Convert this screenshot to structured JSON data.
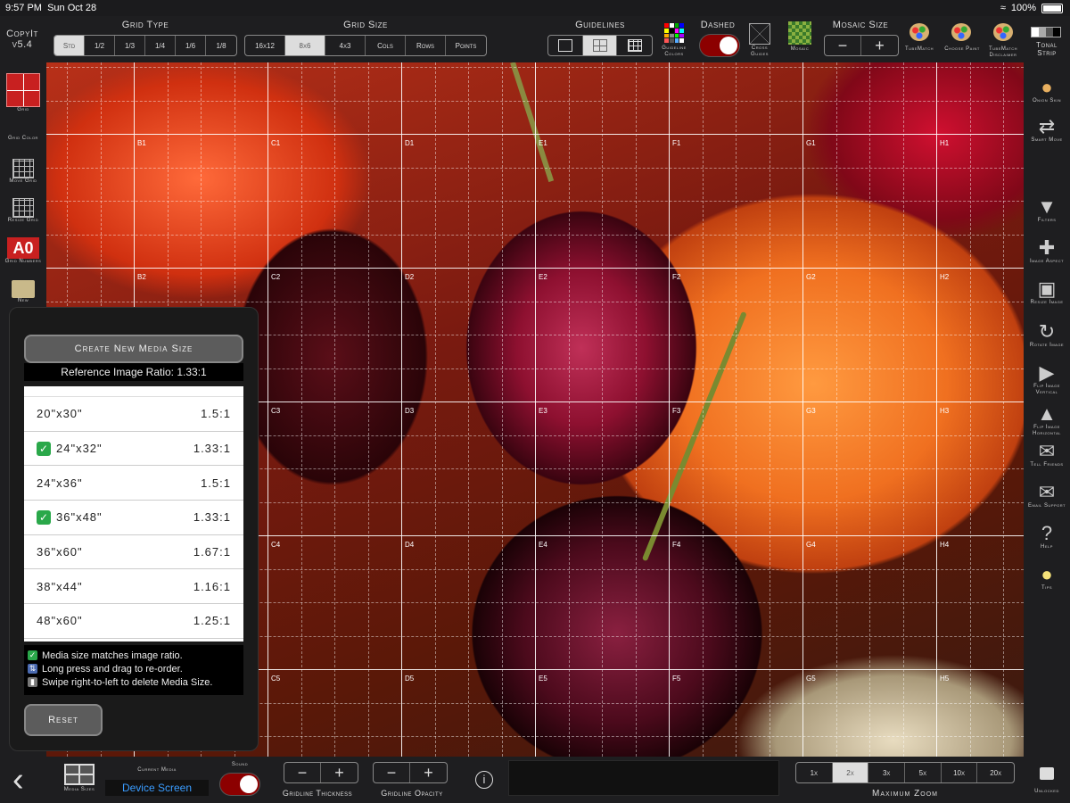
{
  "status": {
    "time": "9:57 PM",
    "date": "Sun Oct 28",
    "battery": "100%"
  },
  "app": {
    "name": "CopyIt",
    "version": "v5.4"
  },
  "toolbar": {
    "grid_type_label": "Grid Type",
    "grid_type_options": [
      "Std",
      "1/2",
      "1/3",
      "1/4",
      "1/6",
      "1/8"
    ],
    "grid_type_selected": "Std",
    "grid_size_label": "Grid Size",
    "grid_size_options": [
      "16x12",
      "8x6",
      "4x3",
      "Cols",
      "Rows",
      "Points"
    ],
    "grid_size_selected": "8x6",
    "guidelines_label": "Guidelines",
    "guideline_colors_label": "Guideline Colors",
    "dashed_label": "Dashed",
    "cross_guides_label": "Cross Guides",
    "mosaic_label": "Mosaic",
    "mosaic_size_label": "Mosaic Size",
    "tubematch_label": "TubeMatch",
    "choose_paint_label": "Choose Paint",
    "tubematch_disclaimer_label": "TubeMatch Disclaimer",
    "tonal_strip_label": "Tonal Strip"
  },
  "left_sidebar": [
    "Grid",
    "Grid Color",
    "Move Grid",
    "Resize Grid",
    "Grid Numbers",
    "New"
  ],
  "grid_numbers_badge": "A0",
  "right_sidebar": [
    "Onion Skin",
    "Smart Move",
    "Filters",
    "Image Aspect",
    "Resize Image",
    "Rotate Image",
    "Flip Image Vertical",
    "Flip Image Horizontal",
    "Tell Friends",
    "Email Support",
    "Help",
    "Tips"
  ],
  "grid_labels": {
    "cols": [
      "B",
      "C",
      "D",
      "E",
      "F",
      "G",
      "H"
    ],
    "rows": [
      "1",
      "2",
      "3",
      "4",
      "5"
    ]
  },
  "panel": {
    "create_button": "Create New Media Size",
    "ratio_text": "Reference Image Ratio: 1.33:1",
    "sizes": [
      {
        "size": "20\"x30\"",
        "ratio": "1.5:1",
        "match": false
      },
      {
        "size": "24\"x32\"",
        "ratio": "1.33:1",
        "match": true
      },
      {
        "size": "24\"x36\"",
        "ratio": "1.5:1",
        "match": false
      },
      {
        "size": "36\"x48\"",
        "ratio": "1.33:1",
        "match": true
      },
      {
        "size": "36\"x60\"",
        "ratio": "1.67:1",
        "match": false
      },
      {
        "size": "38\"x44\"",
        "ratio": "1.16:1",
        "match": false
      },
      {
        "size": "48\"x60\"",
        "ratio": "1.25:1",
        "match": false
      }
    ],
    "legend": [
      "Media size matches image ratio.",
      "Long press and drag to re-order.",
      "Swipe right-to-left to delete Media Size."
    ],
    "reset_button": "Reset"
  },
  "bottom": {
    "media_sizes_label": "Media Sizes",
    "current_media_label": "Current Media",
    "current_media_value": "Device Screen",
    "sound_label": "Sound",
    "gridline_thickness_label": "Gridline Thickness",
    "gridline_opacity_label": "Gridline Opacity",
    "zoom_options": [
      "1x",
      "2x",
      "3x",
      "5x",
      "10x",
      "20x"
    ],
    "zoom_selected": "2x",
    "maximum_zoom_label": "Maximum Zoom",
    "unlocked_label": "Unlocked"
  }
}
